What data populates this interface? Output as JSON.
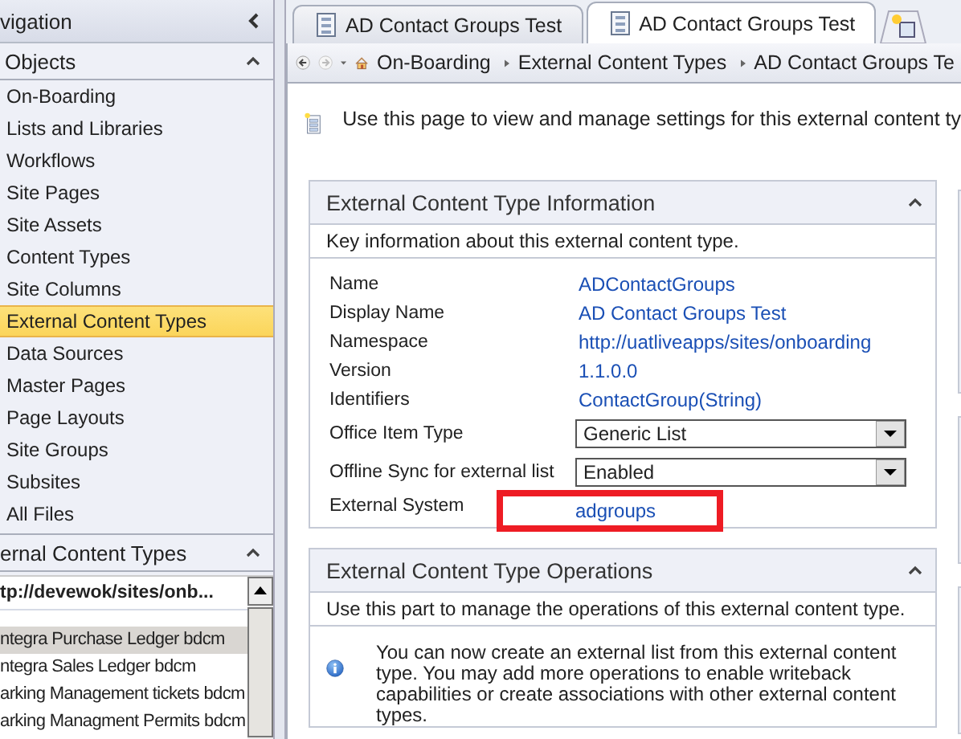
{
  "sidebar": {
    "title": "vigation",
    "objects": {
      "title": "Objects",
      "expanded": true,
      "items": [
        {
          "label": "On-Boarding",
          "selected": false
        },
        {
          "label": "Lists and Libraries",
          "selected": false
        },
        {
          "label": "Workflows",
          "selected": false
        },
        {
          "label": "Site Pages",
          "selected": false
        },
        {
          "label": "Site Assets",
          "selected": false
        },
        {
          "label": "Content Types",
          "selected": false
        },
        {
          "label": "Site Columns",
          "selected": false
        },
        {
          "label": "External Content Types",
          "selected": true
        },
        {
          "label": "Data Sources",
          "selected": false
        },
        {
          "label": "Master Pages",
          "selected": false
        },
        {
          "label": "Page Layouts",
          "selected": false
        },
        {
          "label": "Site Groups",
          "selected": false
        },
        {
          "label": "Subsites",
          "selected": false
        },
        {
          "label": "All Files",
          "selected": false
        }
      ]
    },
    "ect": {
      "title": "ernal Content Types",
      "expanded": true,
      "address": "tp://devewok/sites/onb...",
      "items": [
        {
          "label": "ntegra Purchase Ledger bdcm",
          "selected": true
        },
        {
          "label": "ntegra Sales Ledger bdcm",
          "selected": false
        },
        {
          "label": "arking Management tickets bdcm",
          "selected": false
        },
        {
          "label": "arking Managment Permits bdcm",
          "selected": false
        }
      ]
    }
  },
  "tabs": [
    {
      "label": "AD Contact Groups Test",
      "selected": false
    },
    {
      "label": "AD Contact Groups Test",
      "selected": true
    }
  ],
  "breadcrumb": [
    "On-Boarding",
    "External Content Types",
    "AD Contact Groups Te"
  ],
  "intro": "Use this page to view and manage settings for this external content ty",
  "info_panel": {
    "title": "External Content Type Information",
    "expanded": true,
    "description": "Key information about this external content type.",
    "fields": [
      {
        "label": "Name",
        "kind": "link",
        "value": "ADContactGroups",
        "highlighted": false
      },
      {
        "label": "Display Name",
        "kind": "link",
        "value": "AD Contact Groups Test",
        "highlighted": false
      },
      {
        "label": "Namespace",
        "kind": "link",
        "value": "http://uatliveapps/sites/onboarding",
        "highlighted": false
      },
      {
        "label": "Version",
        "kind": "link",
        "value": "1.1.0.0",
        "highlighted": false
      },
      {
        "label": "Identifiers",
        "kind": "link",
        "value": "ContactGroup(String)",
        "highlighted": false
      },
      {
        "label": "Office Item Type",
        "kind": "dropdown",
        "value": "Generic List",
        "highlighted": false
      },
      {
        "label": "Offline Sync for external list",
        "kind": "dropdown",
        "value": "Enabled",
        "highlighted": false
      },
      {
        "label": "External System",
        "kind": "link",
        "value": "adgroups",
        "highlighted": true
      }
    ]
  },
  "ops_panel": {
    "title": "External Content Type Operations",
    "expanded": true,
    "description": "Use this part to manage the operations of this external content type.",
    "message": "You can now create an external list from this external content type. You may add more operations to enable writeback capabilities or create associations with other external content types."
  }
}
